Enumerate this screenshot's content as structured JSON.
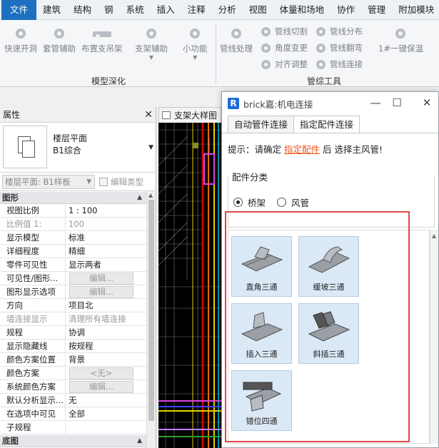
{
  "menubar": {
    "items": [
      "文件",
      "建筑",
      "结构",
      "钢",
      "系统",
      "插入",
      "注释",
      "分析",
      "视图",
      "体量和场地",
      "协作",
      "管理",
      "附加模块"
    ]
  },
  "ribbon": {
    "buttons": {
      "quick_open_hole": "快速开洞",
      "casing_aid": "套管辅助",
      "layout_hanger": "布置支吊架",
      "support_aid": "支架辅助",
      "small_func": "小功能",
      "pipe_process": "管线处理",
      "pipe_cut": "管线切割",
      "angle_change": "角度变更",
      "align_adjust": "对齐调整",
      "pipe_distribute": "管线分布",
      "pipe_flip": "管线翻弯",
      "pipe_connect": "管线连接",
      "one_key_insulate": "1#一键保温"
    },
    "groups": {
      "model_deepen": "模型深化",
      "pipe_tools": "管综工具"
    }
  },
  "properties": {
    "title": "属性",
    "type_name_line1": "楼层平面",
    "type_name_line2": "B1综合",
    "instance_select": "楼层平面: B1样板",
    "edit_type": "编辑类型",
    "section_graphics": "图形",
    "section_base": "底图",
    "rows": [
      {
        "k": "视图比例",
        "v": "1 : 100"
      },
      {
        "k": "比例值 1:",
        "v": "100"
      },
      {
        "k": "显示模型",
        "v": "标准"
      },
      {
        "k": "详细程度",
        "v": "精细"
      },
      {
        "k": "零件可见性",
        "v": "显示两者"
      },
      {
        "k": "可见性/图形...",
        "v": "编辑..."
      },
      {
        "k": "图形显示选项",
        "v": "编辑..."
      },
      {
        "k": "方向",
        "v": "项目北"
      },
      {
        "k": "墙连接显示",
        "v": "清理所有墙连接"
      },
      {
        "k": "规程",
        "v": "协调"
      },
      {
        "k": "显示隐藏线",
        "v": "按规程"
      },
      {
        "k": "颜色方案位置",
        "v": "背景"
      },
      {
        "k": "颜色方案",
        "v": "<无>"
      },
      {
        "k": "系统颜色方案",
        "v": "编辑..."
      },
      {
        "k": "默认分析显示...",
        "v": "无"
      },
      {
        "k": "在选项中可见",
        "v": "全部"
      },
      {
        "k": "子规程",
        "v": ""
      }
    ]
  },
  "view": {
    "tab_label": "支架大样图"
  },
  "dialog": {
    "title": "brick嘉:机电连接",
    "logo": "R",
    "tabs": [
      "自动管件连接",
      "指定配件连接"
    ],
    "hint_prefix": "提示：请确定",
    "hint_highlight": "指定配件",
    "hint_suffix": "后 选择主风管!",
    "group_label": "配件分类",
    "radio_bridge": "桥架",
    "radio_duct": "风管",
    "parts": [
      "直角三通",
      "缓坡三通",
      "插入三通",
      "斜插三通",
      "错位四通"
    ],
    "accent_color": "#e8561c",
    "highlight_box_color": "#e0474c"
  }
}
